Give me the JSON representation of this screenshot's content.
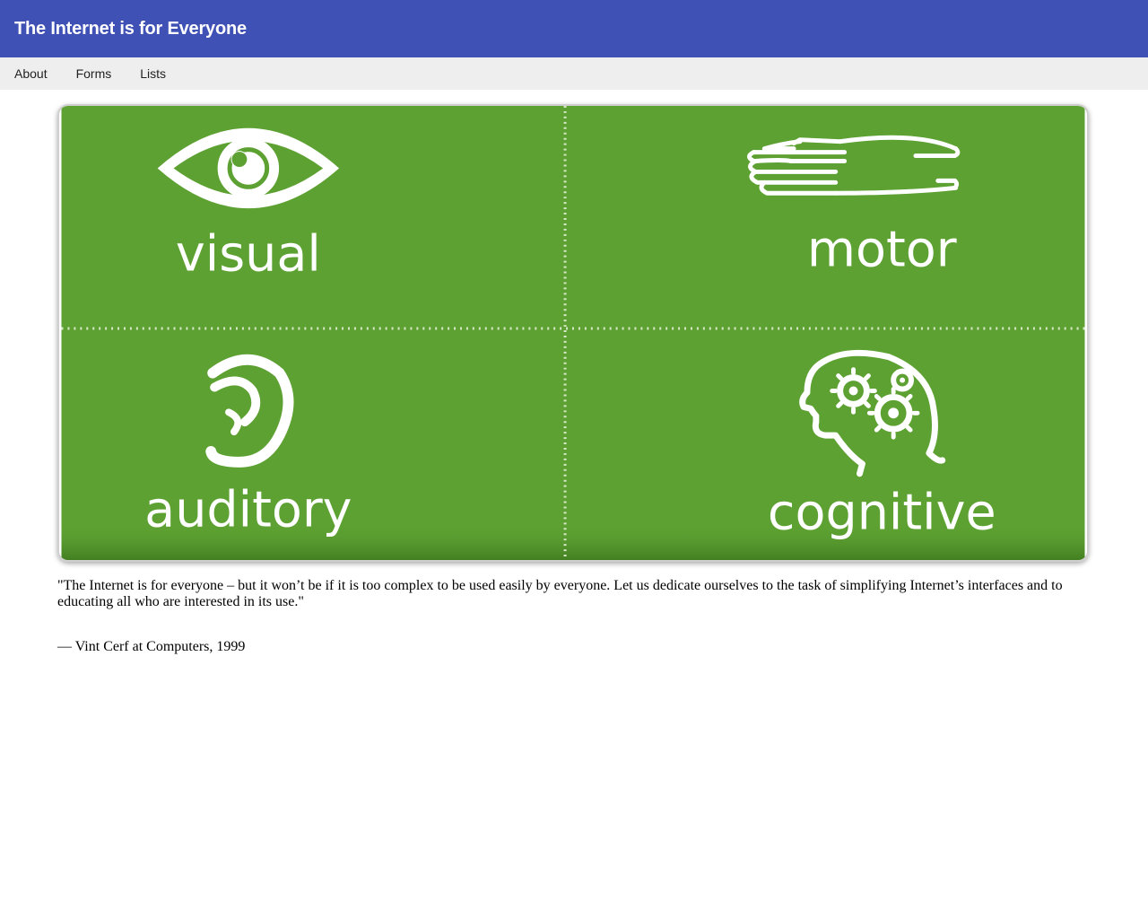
{
  "header": {
    "title": "The Internet is for Everyone",
    "background_color": "#3f51b5"
  },
  "nav": {
    "items": [
      {
        "label": "About"
      },
      {
        "label": "Forms"
      },
      {
        "label": "Lists"
      }
    ]
  },
  "hero": {
    "background_color": "#5da132",
    "quadrants": [
      {
        "label": "visual",
        "icon": "eye-icon"
      },
      {
        "label": "motor",
        "icon": "hand-icon"
      },
      {
        "label": "auditory",
        "icon": "ear-icon"
      },
      {
        "label": "cognitive",
        "icon": "head-gears-icon"
      }
    ]
  },
  "quote": {
    "text": "\"The Internet is for everyone – but it won’t be if it is too complex to be used easily by everyone. Let us dedicate ourselves to the task of simplifying Internet’s interfaces and to educating all who are interested in its use.\"",
    "attribution": "— Vint Cerf at Computers, 1999"
  }
}
